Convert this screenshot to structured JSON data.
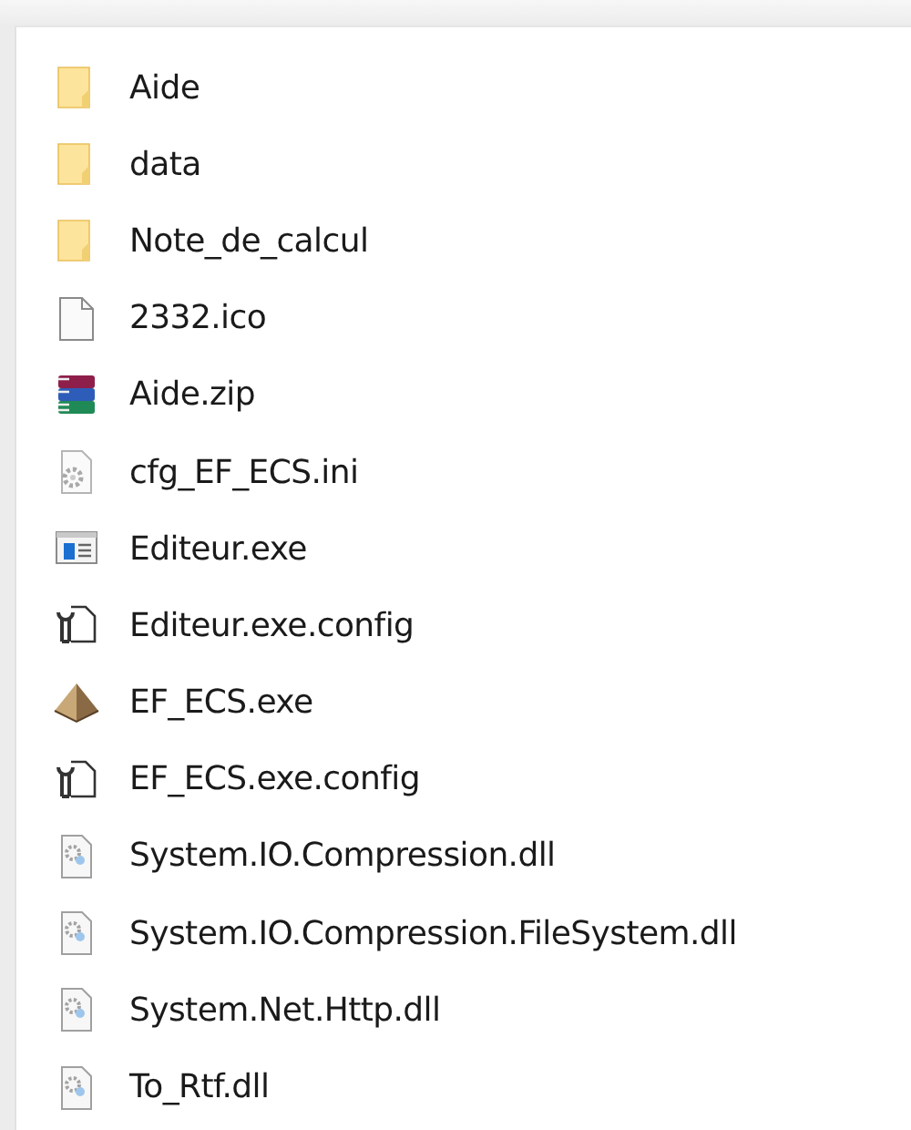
{
  "files": [
    {
      "name": "Aide",
      "kind": "folder"
    },
    {
      "name": "data",
      "kind": "folder"
    },
    {
      "name": "Note_de_calcul",
      "kind": "folder"
    },
    {
      "name": "2332.ico",
      "kind": "file"
    },
    {
      "name": "Aide.zip",
      "kind": "archive"
    },
    {
      "name": "cfg_EF_ECS.ini",
      "kind": "settings"
    },
    {
      "name": "Editeur.exe",
      "kind": "window"
    },
    {
      "name": "Editeur.exe.config",
      "kind": "config"
    },
    {
      "name": "EF_ECS.exe",
      "kind": "pyramid"
    },
    {
      "name": "EF_ECS.exe.config",
      "kind": "config"
    },
    {
      "name": "System.IO.Compression.dll",
      "kind": "dll"
    },
    {
      "name": "System.IO.Compression.FileSystem.dll",
      "kind": "dll"
    },
    {
      "name": "System.Net.Http.dll",
      "kind": "dll"
    },
    {
      "name": "To_Rtf.dll",
      "kind": "dll"
    }
  ]
}
